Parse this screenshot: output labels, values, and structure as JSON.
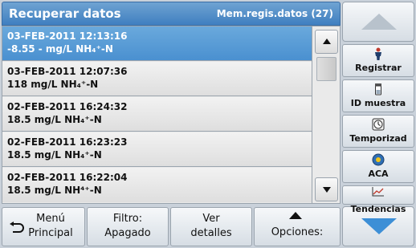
{
  "header": {
    "title": "Recuperar datos",
    "info": "Mem.regis.datos (27)"
  },
  "records": [
    {
      "line1": "03-FEB-2011  12:13:16",
      "line2": "-8.55  -  mg/L  NH₄⁺-N",
      "selected": true
    },
    {
      "line1": "03-FEB-2011  12:07:36",
      "line2": "118  mg/L  NH₄⁺-N",
      "selected": false
    },
    {
      "line1": "02-FEB-2011  16:24:32",
      "line2": "18.5  mg/L  NH₄⁺-N",
      "selected": false
    },
    {
      "line1": "02-FEB-2011  16:23:23",
      "line2": "18.5  mg/L  NH₄⁺-N",
      "selected": false
    },
    {
      "line1": "02-FEB-2011  16:22:04",
      "line2": "18.5  mg/L  NH⁴⁺-N",
      "selected": false
    }
  ],
  "sidebar": {
    "items": [
      {
        "label": "Registrar",
        "icon": "person-icon"
      },
      {
        "label": "ID muestra",
        "icon": "vial-icon"
      },
      {
        "label": "Temporizad",
        "icon": "timer-icon"
      },
      {
        "label": "ACA",
        "icon": "aca-icon"
      },
      {
        "label": "Tendencias",
        "icon": "chart-icon"
      }
    ]
  },
  "bottom": {
    "menu_a": "Menú",
    "menu_b": "Principal",
    "filter_a": "Filtro:",
    "filter_b": "Apagado",
    "details_a": "Ver",
    "details_b": "detalles",
    "options": "Opciones:"
  },
  "colors": {
    "title_bar": "#4a88c8",
    "selection": "#5a9ed6",
    "scroll_down_arrow": "#3d8fd6"
  }
}
